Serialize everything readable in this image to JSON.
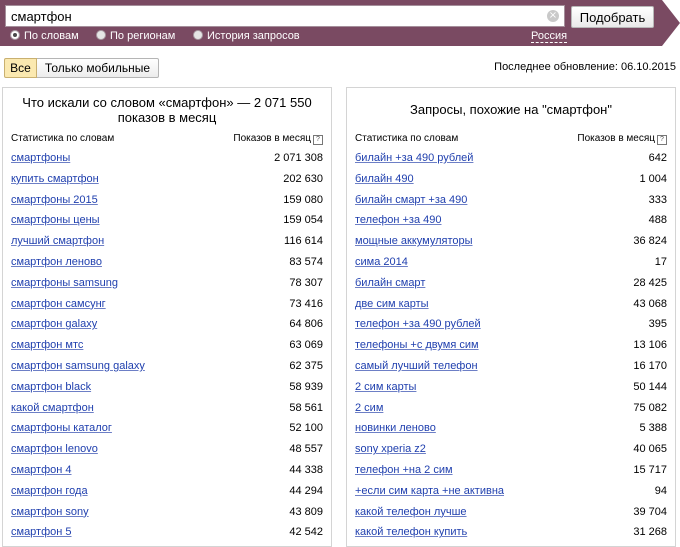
{
  "search": {
    "query": "смартфон",
    "button_label": "Подобрать",
    "clear_glyph": "×",
    "options": [
      {
        "label": "По словам",
        "selected": true
      },
      {
        "label": "По регионам",
        "selected": false
      },
      {
        "label": "История запросов",
        "selected": false
      }
    ],
    "region": "Россия"
  },
  "filters": {
    "all_label": "Все",
    "mobile_label": "Только мобильные",
    "active": "all"
  },
  "last_updated": "Последнее обновление: 06.10.2015",
  "left_panel": {
    "title": "Что искали со словом «смартфон» — 2 071 550 показов в месяц",
    "col_keyword": "Статистика по словам",
    "col_count": "Показов в месяц",
    "rows": [
      {
        "kw": "смартфоны",
        "count": "2 071 308"
      },
      {
        "kw": "купить смартфон",
        "count": "202 630"
      },
      {
        "kw": "смартфоны 2015",
        "count": "159 080"
      },
      {
        "kw": "смартфоны цены",
        "count": "159 054"
      },
      {
        "kw": "лучший смартфон",
        "count": "116 614"
      },
      {
        "kw": "смартфон леново",
        "count": "83 574"
      },
      {
        "kw": "смартфоны samsung",
        "count": "78 307"
      },
      {
        "kw": "смартфон самсунг",
        "count": "73 416"
      },
      {
        "kw": "смартфон galaxy",
        "count": "64 806"
      },
      {
        "kw": "смартфон мтс",
        "count": "63 069"
      },
      {
        "kw": "смартфон samsung galaxy",
        "count": "62 375"
      },
      {
        "kw": "смартфон black",
        "count": "58 939"
      },
      {
        "kw": "какой смартфон",
        "count": "58 561"
      },
      {
        "kw": "смартфоны каталог",
        "count": "52 100"
      },
      {
        "kw": "смартфон lenovo",
        "count": "48 557"
      },
      {
        "kw": "смартфон 4",
        "count": "44 338"
      },
      {
        "kw": "смартфон года",
        "count": "44 294"
      },
      {
        "kw": "смартфон sony",
        "count": "43 809"
      },
      {
        "kw": "смартфон 5",
        "count": "42 542"
      }
    ]
  },
  "right_panel": {
    "title": "Запросы, похожие на \"смартфон\"",
    "col_keyword": "Статистика по словам",
    "col_count": "Показов в месяц",
    "rows": [
      {
        "kw": "билайн +за 490 рублей",
        "count": "642"
      },
      {
        "kw": "билайн 490",
        "count": "1 004"
      },
      {
        "kw": "билайн смарт +за 490",
        "count": "333"
      },
      {
        "kw": "телефон +за 490",
        "count": "488"
      },
      {
        "kw": "мощные аккумуляторы",
        "count": "36 824"
      },
      {
        "kw": "сима 2014",
        "count": "17"
      },
      {
        "kw": "билайн смарт",
        "count": "28 425"
      },
      {
        "kw": "две сим карты",
        "count": "43 068"
      },
      {
        "kw": "телефон +за 490 рублей",
        "count": "395"
      },
      {
        "kw": "телефоны +с двумя сим",
        "count": "13 106"
      },
      {
        "kw": "самый лучший телефон",
        "count": "16 170"
      },
      {
        "kw": "2 сим карты",
        "count": "50 144"
      },
      {
        "kw": "2 сим",
        "count": "75 082"
      },
      {
        "kw": "новинки леново",
        "count": "5 388"
      },
      {
        "kw": "sony xperia z2",
        "count": "40 065"
      },
      {
        "kw": "телефон +на 2 сим",
        "count": "15 717"
      },
      {
        "kw": "+если сим карта +не активна",
        "count": "94"
      },
      {
        "kw": "какой телефон лучше",
        "count": "39 704"
      },
      {
        "kw": "какой телефон купить",
        "count": "31 268"
      }
    ]
  },
  "icons": {
    "clear": "clear-icon",
    "help": "help-icon",
    "radio": "radio-icon"
  },
  "colors": {
    "header": "#7a4a62",
    "link": "#1f3fae",
    "active_filter": "#fbe9b0"
  }
}
